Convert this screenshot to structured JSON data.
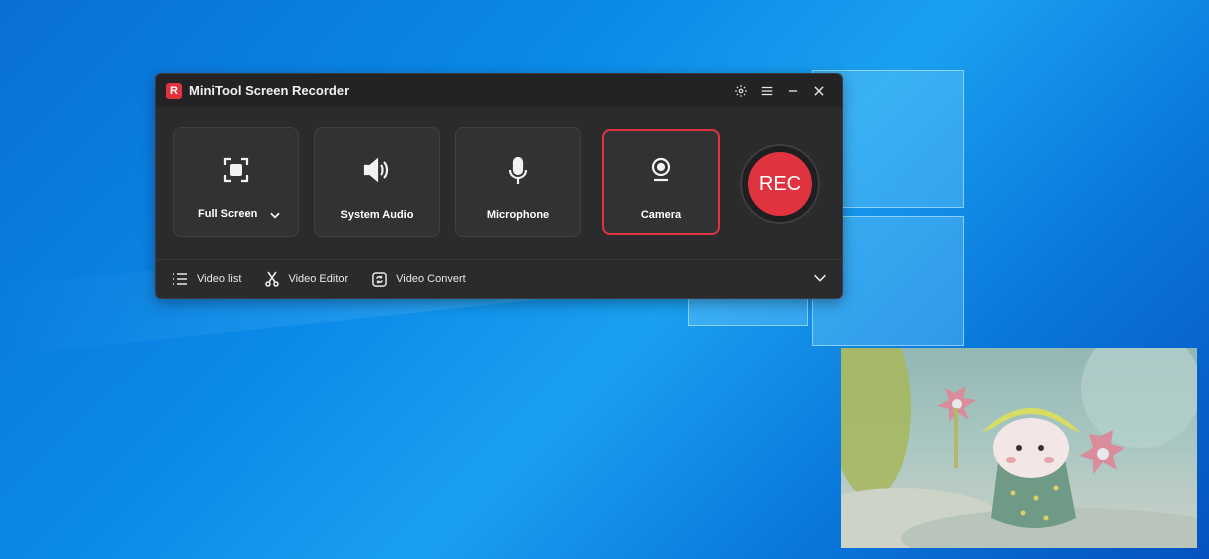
{
  "window": {
    "app_logo_letter": "R",
    "title": "MiniTool Screen Recorder",
    "controls": [
      "settings-icon",
      "menu-icon",
      "minimize-icon",
      "close-icon"
    ]
  },
  "modes": [
    {
      "label": "Full Screen",
      "icon": "full-screen-icon",
      "has_dropdown": true
    },
    {
      "label": "System Audio",
      "icon": "speaker-icon"
    },
    {
      "label": "Microphone",
      "icon": "microphone-icon"
    },
    {
      "label": "Camera",
      "icon": "camera-icon",
      "selected": true
    }
  ],
  "rec_button": {
    "label": "REC",
    "color": "#e1323f"
  },
  "bottom_bar": {
    "items": [
      {
        "label": "Video list",
        "icon": "list-icon"
      },
      {
        "label": "Video Editor",
        "icon": "scissors-icon"
      },
      {
        "label": "Video Convert",
        "icon": "convert-icon"
      }
    ],
    "expand_icon": "chevron-down-icon"
  },
  "colors": {
    "accent": "#e1323f",
    "window_bg": "#2b2b2d"
  }
}
